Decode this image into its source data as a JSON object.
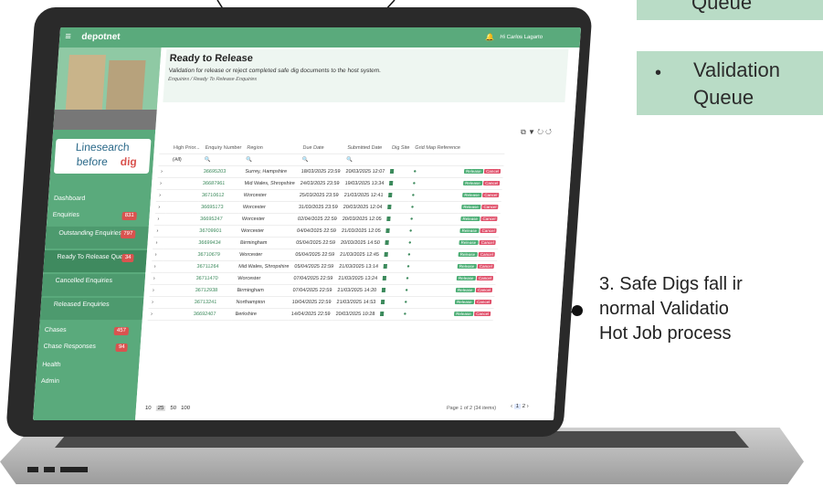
{
  "callouts": {
    "box1_text": "Queue",
    "box2_bullet": "•",
    "box2_line1": "Validation",
    "box2_line2": "Queue",
    "note_line1": "3. Safe Digs fall ir",
    "note_line2": "normal Validatio",
    "note_line3": "Hot Job process"
  },
  "app": {
    "brand": "depotnet",
    "user": "Hi Carlos Lagarto",
    "logo_line1": "Linesearch",
    "logo_line2": "before",
    "logo_line3": "dig"
  },
  "sidebar": {
    "items": [
      {
        "label": "Dashboard"
      },
      {
        "label": "Enquiries",
        "badge": "831"
      },
      {
        "label": "Outstanding Enquiries",
        "badge": "797"
      },
      {
        "label": "Ready To Release Queue",
        "badge": "34"
      },
      {
        "label": "Cancelled Enquiries"
      },
      {
        "label": "Released Enquiries"
      },
      {
        "label": "Chases",
        "badge": "457"
      },
      {
        "label": "Chase Responses",
        "badge": "94"
      },
      {
        "label": "Health"
      },
      {
        "label": "Admin"
      }
    ]
  },
  "main": {
    "title": "Ready to Release",
    "subtitle": "Validation for release or reject completed safe dig documents to the host system.",
    "breadcrumb": "Enquiries / Ready To Release Enquiries",
    "filter_all": "(All)",
    "columns": [
      "High Prior...",
      "Enquiry Number",
      "Region",
      "Due Date",
      "Submitted Date",
      "Dig Site",
      "Grid Map Reference"
    ],
    "release_label": "Release",
    "cancel_label": "Cancel",
    "rows": [
      [
        "36695203",
        "Surrey, Hampshire",
        "18/03/2025 23:59",
        "20/03/2025 12:07"
      ],
      [
        "36687961",
        "Mid Wales, Shropshire",
        "24/03/2025 23:59",
        "19/03/2025 13:34"
      ],
      [
        "36710612",
        "Worcester",
        "25/03/2025 23:59",
        "21/03/2025 12:41"
      ],
      [
        "36695173",
        "Worcester",
        "31/03/2025 23:59",
        "20/03/2025 12:04"
      ],
      [
        "36695247",
        "Worcester",
        "02/04/2025 22:59",
        "20/03/2025 12:05"
      ],
      [
        "36709901",
        "Worcester",
        "04/04/2025 22:59",
        "21/03/2025 12:05"
      ],
      [
        "36699434",
        "Birmingham",
        "05/04/2025 22:59",
        "20/03/2025 14:50"
      ],
      [
        "36710679",
        "Worcester",
        "05/04/2025 22:59",
        "21/03/2025 12:45"
      ],
      [
        "36711264",
        "Mid Wales, Shropshire",
        "05/04/2025 22:59",
        "21/03/2025 13:14"
      ],
      [
        "36711470",
        "Worcester",
        "07/04/2025 22:59",
        "21/03/2025 13:24"
      ],
      [
        "36712938",
        "Birmingham",
        "07/04/2025 22:59",
        "21/03/2025 14:20"
      ],
      [
        "36713241",
        "Northampton",
        "10/04/2025 22:59",
        "21/03/2025 14:53"
      ],
      [
        "36692407",
        "Berkshire",
        "14/04/2025 22:59",
        "20/03/2025 10:28"
      ]
    ],
    "page_sizes": [
      "10",
      "25",
      "50",
      "100"
    ],
    "pager_info": "Page 1 of 2 (34 items)",
    "pages": [
      "1",
      "2"
    ]
  }
}
